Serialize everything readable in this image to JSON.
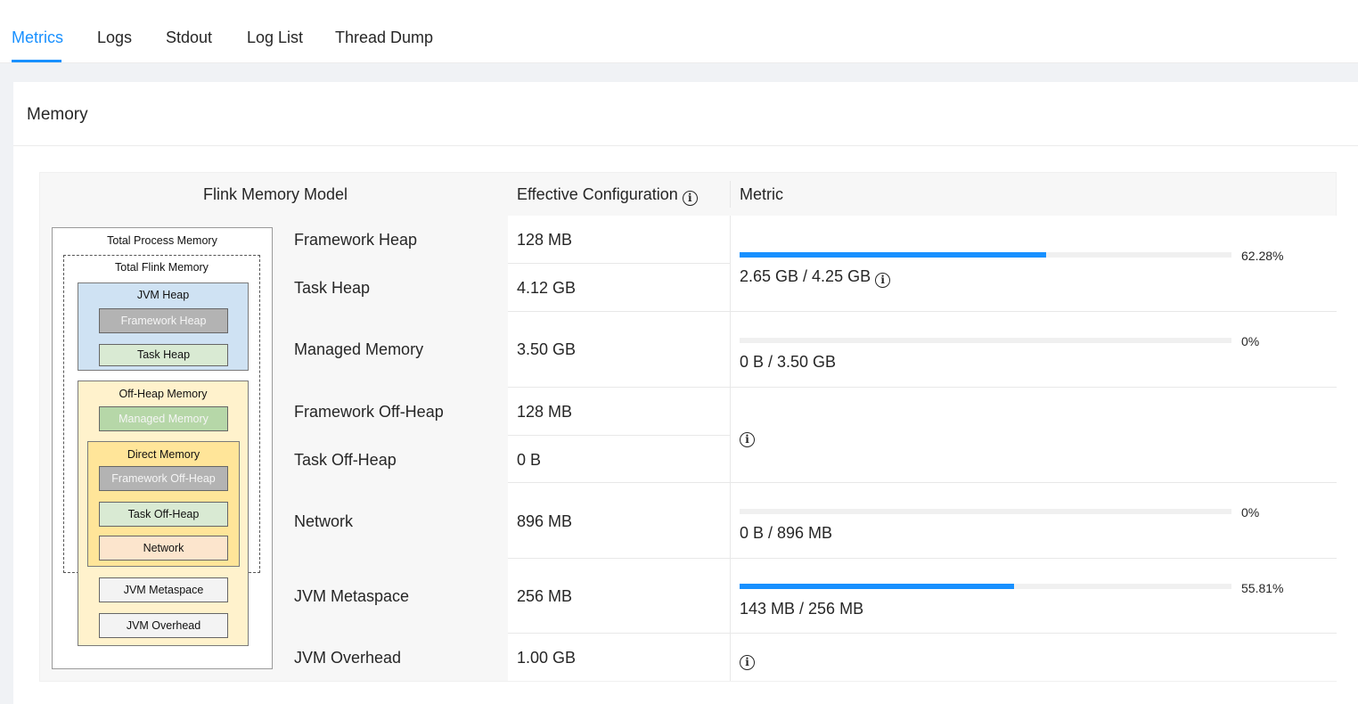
{
  "tabs": [
    "Metrics",
    "Logs",
    "Stdout",
    "Log List",
    "Thread Dump"
  ],
  "active_tab": "Metrics",
  "card_title": "Memory",
  "table": {
    "headers": {
      "model": "Flink Memory Model",
      "config": "Effective Configuration",
      "metric": "Metric"
    }
  },
  "diagram": {
    "total_process": "Total Process Memory",
    "total_flink": "Total Flink Memory",
    "jvm_heap": "JVM Heap",
    "framework_heap": "Framework Heap",
    "task_heap": "Task Heap",
    "off_heap": "Off-Heap Memory",
    "managed_memory": "Managed Memory",
    "direct_memory": "Direct Memory",
    "framework_off_heap": "Framework Off-Heap",
    "task_off_heap": "Task Off-Heap",
    "network": "Network",
    "jvm_metaspace": "JVM Metaspace",
    "jvm_overhead": "JVM Overhead",
    "colors": {
      "heap": "#cfe2f3",
      "gray": "#b3b3b3",
      "green": "#d9ead3",
      "managed": "#b6d7a8",
      "offheap": "#fff2cc",
      "direct": "#ffe599",
      "network": "#fce5cd",
      "light": "#f3f3f3"
    }
  },
  "rows": [
    {
      "name": "Framework Heap",
      "config": "128 MB"
    },
    {
      "name": "Task Heap",
      "config": "4.12 GB"
    },
    {
      "name": "Managed Memory",
      "config": "3.50 GB"
    },
    {
      "name": "Framework Off-Heap",
      "config": "128 MB"
    },
    {
      "name": "Task Off-Heap",
      "config": "0 B"
    },
    {
      "name": "Network",
      "config": "896 MB"
    },
    {
      "name": "JVM Metaspace",
      "config": "256 MB"
    },
    {
      "name": "JVM Overhead",
      "config": "1.00 GB"
    }
  ],
  "metrics": {
    "heap": {
      "percent_label": "62.28%",
      "fraction": 0.6228,
      "usage": "2.65 GB / 4.25 GB"
    },
    "managed": {
      "percent_label": "0%",
      "fraction": 0,
      "usage": "0 B / 3.50 GB"
    },
    "network": {
      "percent_label": "0%",
      "fraction": 0,
      "usage": "0 B / 896 MB"
    },
    "metaspace": {
      "percent_label": "55.81%",
      "fraction": 0.5581,
      "usage": "143 MB / 256 MB"
    }
  },
  "icons": {
    "info": "info-circle-icon"
  },
  "accent_color": "#1890ff"
}
